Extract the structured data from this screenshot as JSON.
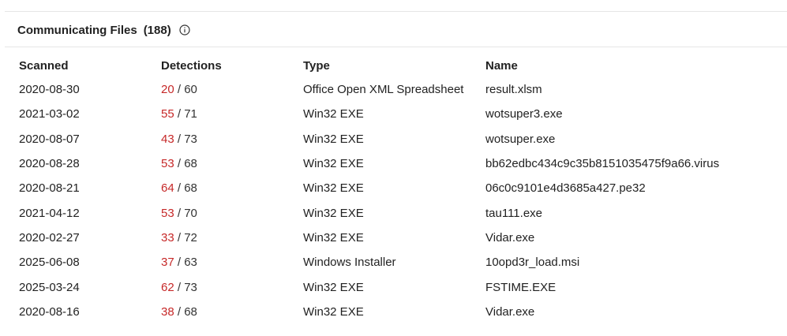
{
  "section": {
    "title": "Communicating Files",
    "count": "(188)",
    "info_icon": "info-circle-icon"
  },
  "columns": {
    "scanned": "Scanned",
    "detections": "Detections",
    "type": "Type",
    "name": "Name"
  },
  "rows": [
    {
      "scanned": "2020-08-30",
      "detections_positive": "20",
      "detections_total": "60",
      "type": "Office Open XML Spreadsheet",
      "name": "result.xlsm"
    },
    {
      "scanned": "2021-03-02",
      "detections_positive": "55",
      "detections_total": "71",
      "type": "Win32 EXE",
      "name": "wotsuper3.exe"
    },
    {
      "scanned": "2020-08-07",
      "detections_positive": "43",
      "detections_total": "73",
      "type": "Win32 EXE",
      "name": "wotsuper.exe"
    },
    {
      "scanned": "2020-08-28",
      "detections_positive": "53",
      "detections_total": "68",
      "type": "Win32 EXE",
      "name": "bb62edbc434c9c35b8151035475f9a66.virus"
    },
    {
      "scanned": "2020-08-21",
      "detections_positive": "64",
      "detections_total": "68",
      "type": "Win32 EXE",
      "name": "06c0c9101e4d3685a427.pe32"
    },
    {
      "scanned": "2021-04-12",
      "detections_positive": "53",
      "detections_total": "70",
      "type": "Win32 EXE",
      "name": "tau111.exe"
    },
    {
      "scanned": "2020-02-27",
      "detections_positive": "33",
      "detections_total": "72",
      "type": "Win32 EXE",
      "name": "Vidar.exe"
    },
    {
      "scanned": "2025-06-08",
      "detections_positive": "37",
      "detections_total": "63",
      "type": "Windows Installer",
      "name": "10opd3r_load.msi"
    },
    {
      "scanned": "2025-03-24",
      "detections_positive": "62",
      "detections_total": "73",
      "type": "Win32 EXE",
      "name": "FSTIME.EXE"
    },
    {
      "scanned": "2020-08-16",
      "detections_positive": "38",
      "detections_total": "68",
      "type": "Win32 EXE",
      "name": "Vidar.exe"
    }
  ],
  "colors": {
    "detection_positive": "#c62828",
    "text": "#222222",
    "rule": "#e6e6e6"
  }
}
